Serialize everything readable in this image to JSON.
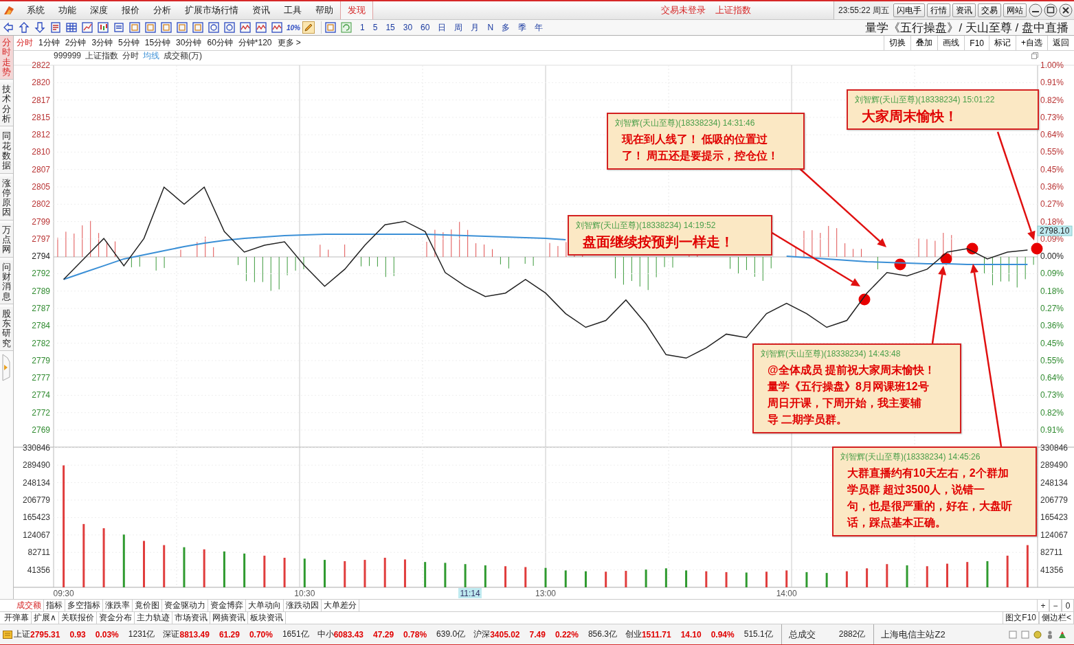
{
  "menu": [
    {
      "label": "系统"
    },
    {
      "label": "功能"
    },
    {
      "label": "深度"
    },
    {
      "label": "报价"
    },
    {
      "label": "分析"
    },
    {
      "label": "扩展市场行情"
    },
    {
      "label": "资讯"
    },
    {
      "label": "工具"
    },
    {
      "label": "帮助"
    }
  ],
  "discover_tab": "发现",
  "status_notices": [
    "交易未登录",
    "上证指数"
  ],
  "clock": "23:55:22 周五",
  "top_buttons": [
    "闪电手",
    "行情",
    "资讯",
    "交易",
    "网站"
  ],
  "toolbar": {
    "percent_label": "10%",
    "periods": [
      "1",
      "5",
      "15",
      "30",
      "60",
      "日",
      "周",
      "月",
      "N",
      "多",
      "季",
      "年"
    ],
    "title": "量学《五行操盘》/ 天山至尊 / 盘中直播"
  },
  "side_tabs": [
    {
      "label": "分时走势",
      "selected": true
    },
    {
      "label": "技术分析",
      "selected": false
    },
    {
      "label": "同花数据",
      "selected": false
    },
    {
      "label": "涨停原因",
      "selected": false
    },
    {
      "label": "万点网",
      "selected": false
    },
    {
      "label": "问财消息",
      "selected": false
    },
    {
      "label": "股东研究",
      "selected": false
    }
  ],
  "period_tabs": [
    {
      "label": "分时",
      "selected": true
    },
    {
      "label": "1分钟",
      "selected": false
    },
    {
      "label": "2分钟",
      "selected": false
    },
    {
      "label": "3分钟",
      "selected": false
    },
    {
      "label": "5分钟",
      "selected": false
    },
    {
      "label": "15分钟",
      "selected": false
    },
    {
      "label": "30分钟",
      "selected": false
    },
    {
      "label": "60分钟",
      "selected": false
    },
    {
      "label": "分钟*120",
      "selected": false
    },
    {
      "label": "更多 >",
      "selected": false
    }
  ],
  "chart_actions": [
    "切换",
    "叠加",
    "画线",
    "F10",
    "标记",
    "+自选",
    "返回"
  ],
  "chart_header": {
    "code": "999999",
    "mode": "分时",
    "volume_label": "成交额(万)"
  },
  "price_chart": {
    "chart_data": {
      "type": "line",
      "categories": [
        null,
        null,
        null,
        null,
        null,
        null,
        null,
        null,
        null,
        null,
        null,
        null,
        null,
        null,
        null,
        null,
        null,
        null,
        null,
        null,
        null,
        null,
        null,
        null,
        null,
        null,
        null,
        null,
        null,
        null,
        null,
        null,
        null,
        null,
        null,
        null,
        null,
        null,
        null,
        null,
        null,
        null,
        null,
        null,
        null,
        null,
        null,
        null,
        null
      ],
      "series": [
        {
          "name": "上证指数",
          "color": "#222222",
          "values": [
            2791,
            2794,
            2797,
            2793,
            2797,
            2804.5,
            2802,
            2804.5,
            2798,
            2795,
            2796,
            2796.5,
            2793,
            2790,
            2792.5,
            2796,
            2799,
            2799.5,
            2798,
            2792,
            2790,
            2788.5,
            2789,
            2791,
            2789,
            2786,
            2784,
            2785,
            2788,
            2784.5,
            2780,
            2779.5,
            2781,
            2783,
            2782.5,
            2786,
            2787.5,
            2786,
            2784,
            2785,
            2789,
            2792,
            2791.5,
            2792.5,
            2795,
            2795.5,
            2794,
            2795,
            2795.3
          ]
        },
        {
          "name": "均线",
          "color": "#3a8fd6",
          "values": [
            2791,
            2792,
            2793,
            2794,
            2794.6,
            2795.2,
            2795.8,
            2796.3,
            2796.7,
            2797,
            2797.2,
            2797.4,
            2797.5,
            2797.6,
            2797.6,
            2797.6,
            2797.6,
            2797.6,
            2797.6,
            2797.5,
            2797.4,
            2797.3,
            2797.2,
            2797.1,
            2797,
            2796.8,
            null,
            null,
            null,
            null,
            null,
            null,
            null,
            null,
            null,
            null,
            2794.4,
            2794.2,
            2794,
            2793.8,
            2793.6,
            2793.5,
            2793.4,
            2793.3,
            2793.3,
            2793.2,
            2793.2,
            2793.2,
            2793.2
          ]
        }
      ],
      "ylim": [
        2768.98,
        2822.32
      ],
      "yticks": [
        {
          "value": 2822.32,
          "label": "2822"
        },
        {
          "value": 2819.78,
          "label": "2820"
        },
        {
          "value": 2817.24,
          "label": "2817"
        },
        {
          "value": 2814.7,
          "label": "2815"
        },
        {
          "value": 2812.16,
          "label": "2812"
        },
        {
          "value": 2809.62,
          "label": "2810"
        },
        {
          "value": 2807.08,
          "label": "2807"
        },
        {
          "value": 2804.54,
          "label": "2805"
        },
        {
          "value": 2802,
          "label": "2802"
        },
        {
          "value": 2799.46,
          "label": "2799"
        },
        {
          "value": 2796.92,
          "label": "2797"
        },
        {
          "value": 2794.38,
          "label": "2794"
        },
        {
          "value": 2791.84,
          "label": "2792"
        },
        {
          "value": 2789.29,
          "label": "2789"
        },
        {
          "value": 2786.75,
          "label": "2787"
        },
        {
          "value": 2784.22,
          "label": "2784"
        },
        {
          "value": 2781.68,
          "label": "2782"
        },
        {
          "value": 2779.14,
          "label": "2779"
        },
        {
          "value": 2776.6,
          "label": "2777"
        },
        {
          "value": 2774.06,
          "label": "2774"
        },
        {
          "value": 2771.52,
          "label": "2772"
        },
        {
          "value": 2768.98,
          "label": "2769"
        }
      ],
      "grid": true
    },
    "right_labels": [
      "1.00%",
      "0.91%",
      "0.82%",
      "0.73%",
      "0.64%",
      "0.55%",
      "0.45%",
      "0.36%",
      "0.27%",
      "0.18%",
      "0.09%",
      "0.00%",
      "0.09%",
      "0.18%",
      "0.27%",
      "0.36%",
      "0.45%",
      "0.55%",
      "0.64%",
      "0.73%",
      "0.82%",
      "0.91%"
    ],
    "price_tag": "2798.10"
  },
  "volume_chart": {
    "chart_data": {
      "type": "bar",
      "categories": [
        "09:30",
        null,
        null,
        null,
        null,
        null,
        null,
        null,
        null,
        null,
        null,
        null,
        "10:30",
        null,
        null,
        null,
        null,
        null,
        null,
        null,
        null,
        null,
        null,
        null,
        "13:00",
        null,
        null,
        null,
        null,
        null,
        null,
        null,
        null,
        null,
        null,
        null,
        "14:00",
        null,
        null,
        null,
        null,
        null,
        null,
        null,
        null,
        null,
        null,
        null,
        null
      ],
      "series": [
        {
          "color": "#e03c3c",
          "values": [
            289000,
            150000,
            140000,
            null,
            110000,
            100000,
            null,
            90000,
            null,
            null,
            75000,
            70000,
            null,
            null,
            62000,
            65000,
            70000,
            66000,
            null,
            null,
            null,
            null,
            50000,
            48000,
            null,
            null,
            null,
            37000,
            39000,
            null,
            null,
            null,
            38000,
            36000,
            null,
            37000,
            40000,
            null,
            null,
            38000,
            45000,
            55000,
            null,
            50000,
            56000,
            60000,
            null,
            75000,
            100000
          ]
        },
        {
          "color": "#2f9a2f",
          "values": [
            null,
            null,
            null,
            125000,
            null,
            null,
            95000,
            null,
            85000,
            80000,
            null,
            null,
            68000,
            65000,
            null,
            null,
            null,
            null,
            60000,
            58000,
            55000,
            52000,
            null,
            null,
            46000,
            40000,
            38000,
            null,
            null,
            42000,
            45000,
            40000,
            null,
            null,
            35000,
            null,
            null,
            36000,
            34000,
            null,
            null,
            null,
            52000,
            null,
            null,
            null,
            62000,
            null,
            null
          ]
        }
      ],
      "ylim": [
        0,
        332147
      ],
      "yticks": [
        {
          "value": 330846,
          "label": "330846"
        },
        {
          "value": 289490.25,
          "label": "289490"
        },
        {
          "value": 248134.5,
          "label": "248134"
        },
        {
          "value": 206778.75,
          "label": "206779"
        },
        {
          "value": 165423,
          "label": "165423"
        },
        {
          "value": 124067.25,
          "label": "124067"
        },
        {
          "value": 82711.5,
          "label": "82711"
        },
        {
          "value": 41355.75,
          "label": "41356"
        }
      ],
      "grid": true
    },
    "right_labels": [
      "330846",
      "289490",
      "248134",
      "206779",
      "165423",
      "124067",
      "82711",
      "41356"
    ]
  },
  "cursor_time": "11:14",
  "annotations": [
    {
      "header": "刘智辉(天山至尊)(18338234) 14:31:46",
      "lines": [
        "现在到人线了！ 低吸的位置过",
        "了！ 周五还是要提示，控仓位！"
      ]
    },
    {
      "header": "刘智辉(天山至尊)(18338234) 15:01:22",
      "lines": [
        "大家周末愉快！"
      ]
    },
    {
      "header": "刘智辉(天山至尊)(18338234) 14:19:52",
      "lines": [
        "盘面继续按预判一样走！"
      ]
    },
    {
      "header": "刘智辉(天山至尊)(18338234) 14:43:48",
      "lines": [
        "@全体成员 提前祝大家周末愉快！",
        "量学《五行操盘》8月网课班12号",
        "周日开课，下周开始，我主要辅",
        "导 二期学员群。"
      ]
    },
    {
      "header": "刘智辉(天山至尊)(18338234) 14:45:26",
      "lines": [
        "大群直播约有10天左右，2个群加",
        "学员群 超过3500人，说错一",
        "句，也是很严重的，好在，大盘听",
        "话，踩点基本正确。"
      ]
    }
  ],
  "indicator_tabs": [
    {
      "label": "成交额",
      "selected": true
    },
    {
      "label": "指标",
      "selected": false
    },
    {
      "label": "多空指标",
      "selected": false
    },
    {
      "label": "涨跌率",
      "selected": false
    },
    {
      "label": "竟价图",
      "selected": false
    },
    {
      "label": "资金驱动力",
      "selected": false
    },
    {
      "label": "资金博弈",
      "selected": false
    },
    {
      "label": "大单动向",
      "selected": false
    },
    {
      "label": "涨跌动因",
      "selected": false
    },
    {
      "label": "大单差分",
      "selected": false
    }
  ],
  "zoom_controls": [
    "+",
    "−",
    "0"
  ],
  "info_tabs": [
    "开弹幕",
    "扩展∧",
    "关联报价",
    "资金分布",
    "主力轨迹",
    "市场资讯",
    "网摘资讯",
    "板块资讯"
  ],
  "panel_links": [
    "图文F10",
    "侧边栏<"
  ],
  "ticker": [
    {
      "name": "上证",
      "price": "2795.31",
      "change": "0.93",
      "pct": "0.03%",
      "amount": "1231亿"
    },
    {
      "name": "深证",
      "price": "8813.49",
      "change": "61.29",
      "pct": "0.70%",
      "amount": "1651亿"
    },
    {
      "name": "中小",
      "price": "6083.43",
      "change": "47.29",
      "pct": "0.78%",
      "amount": "639.0亿"
    },
    {
      "name": "沪深",
      "price": "3405.02",
      "change": "7.49",
      "pct": "0.22%",
      "amount": "856.3亿"
    },
    {
      "name": "创业",
      "price": "1511.71",
      "change": "14.10",
      "pct": "0.94%",
      "amount": "515.1亿"
    }
  ],
  "total": {
    "label": "总成交",
    "value": "2882亿"
  },
  "server": "上海电信主站Z2"
}
